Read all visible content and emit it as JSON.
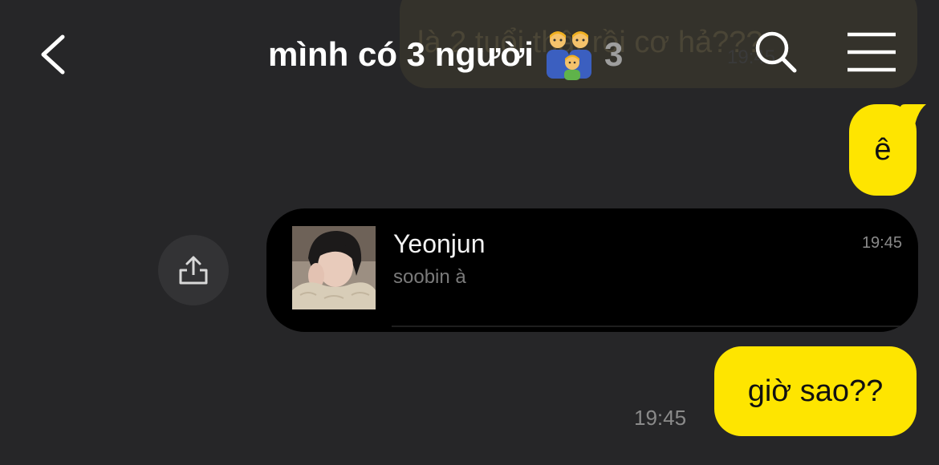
{
  "background_message": {
    "text": "là 2 tuổi thật rồi cơ hả???",
    "time": "19:45"
  },
  "header": {
    "title": "mình có 3 người",
    "member_count": "3"
  },
  "messages": [
    {
      "text": "ê"
    },
    {
      "shared_card": {
        "name": "Yeonjun",
        "preview": "soobin à",
        "time": "19:45"
      }
    },
    {
      "text": "giờ sao??",
      "time": "19:45"
    }
  ],
  "colors": {
    "background": "#262628",
    "my_bubble": "#fee500",
    "card": "#000000",
    "muted_text": "#8a8a8a"
  },
  "icons": {
    "back": "chevron-left-icon",
    "search": "search-icon",
    "menu": "menu-icon",
    "share": "share-icon",
    "title_emoji": "family-man-man-boy-emoji"
  }
}
